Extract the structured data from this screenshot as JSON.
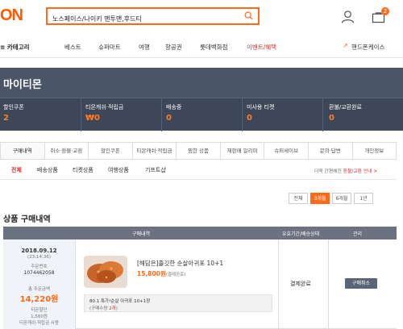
{
  "header": {
    "logo_text": "ON",
    "search_value": "노스페이스/나이키 맨투맨,후드티",
    "cart_count": "2"
  },
  "nav": {
    "category_label": "카테고리",
    "items": [
      "베스트",
      "슈퍼마트",
      "여행",
      "항공권",
      "롯데백화점",
      "이벤트/혜택"
    ],
    "right_label": "핸드폰케이스"
  },
  "mypage": {
    "title": "마이티몬",
    "stats": [
      {
        "label": "할인쿠폰",
        "value": "2"
      },
      {
        "label": "티몬캐쉬·적립금",
        "value": "₩0"
      },
      {
        "label": "배송중",
        "value": "0"
      },
      {
        "label": "미사용 티켓",
        "value": "0"
      },
      {
        "label": "환불/교환완료",
        "value": "0"
      }
    ]
  },
  "tabs": [
    "구매내역",
    "취소·환불·교환",
    "할인쿠폰",
    "티몬캐쉬·적립금",
    "찜한 상품",
    "재판매 알리미",
    "슈퍼세이브",
    "문의·답변",
    "개인정보"
  ],
  "subtabs": [
    "전체",
    "배송상품",
    "티켓상품",
    "여행상품",
    "기프트샵"
  ],
  "sub_note_prefix": "더욱 간편해진 ",
  "sub_note_link": "환불/교환 안내 >",
  "period_buttons": [
    "전체",
    "3개월",
    "6개월",
    "1년"
  ],
  "section_title": "상품 구매내역",
  "table": {
    "headers": [
      "구매내역",
      "유효기간/배송상태",
      "관리"
    ],
    "order": {
      "date": "2018.09.12",
      "time": "(23:14:36)",
      "order_no_label": "주문번호",
      "order_no": "1074462058",
      "total_label": "총 주문금액",
      "total": "14,220원",
      "discount_label": "티몬할인",
      "discount": "1,580원",
      "cash_label": "티몬캐쉬·적립금 사용",
      "product_name": "[해담은]졸깃한 순살아귀포 10+1",
      "price": "15,800원",
      "price_note": "(결제완료)",
      "option_name": "80.1 특가!순살 아귀포 10+1장",
      "option_qty_prefix": "(구매수량 ",
      "option_qty": "2개",
      "option_qty_suffix": ")",
      "status": "결제완료",
      "cancel_label": "구매취소"
    }
  }
}
